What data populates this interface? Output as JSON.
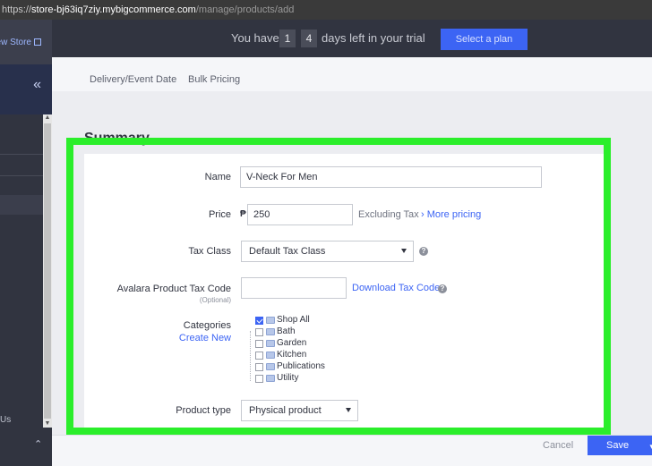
{
  "browser": {
    "url_prefix": "https://",
    "url_host": "store-bj63iq7ziy.mybigcommerce.com",
    "url_path": "/manage/products/add"
  },
  "sidebar": {
    "view_store_label": "ew Store",
    "collapse_icon": "double-chevron-left-icon",
    "bottom_text": "Us",
    "bottom_icon": "chevron-up-icon"
  },
  "trial": {
    "text_before": "You have",
    "digits": [
      "1",
      "4"
    ],
    "text_after": "days left in your trial",
    "select_plan_label": "Select a plan"
  },
  "tabs": {
    "items": [
      "Delivery/Event Date",
      "Bulk Pricing"
    ]
  },
  "section_title": "Summary",
  "form": {
    "name_label": "Name",
    "name_value": "V-Neck For Men",
    "price_label": "Price",
    "currency_symbol": "₱",
    "price_value": "250",
    "excluding_tax": "Excluding Tax",
    "more_pricing": "› More pricing",
    "tax_class_label": "Tax Class",
    "tax_class_value": "Default Tax Class",
    "avalara_label": "Avalara Product Tax Code",
    "avalara_optional": "(Optional)",
    "avalara_value": "",
    "download_tax_codes": "Download Tax Codes",
    "categories_label": "Categories",
    "create_new": "Create New",
    "categories": [
      {
        "name": "Shop All",
        "checked": true
      },
      {
        "name": "Bath",
        "checked": false
      },
      {
        "name": "Garden",
        "checked": false
      },
      {
        "name": "Kitchen",
        "checked": false
      },
      {
        "name": "Publications",
        "checked": false
      },
      {
        "name": "Utility",
        "checked": false
      }
    ],
    "product_type_label": "Product type",
    "product_type_value": "Physical product"
  },
  "footer": {
    "cancel_label": "Cancel",
    "save_label": "Save"
  },
  "colors": {
    "highlight_frame": "#2bee2b",
    "primary": "#3c64f4",
    "sidebar": "#313440"
  }
}
